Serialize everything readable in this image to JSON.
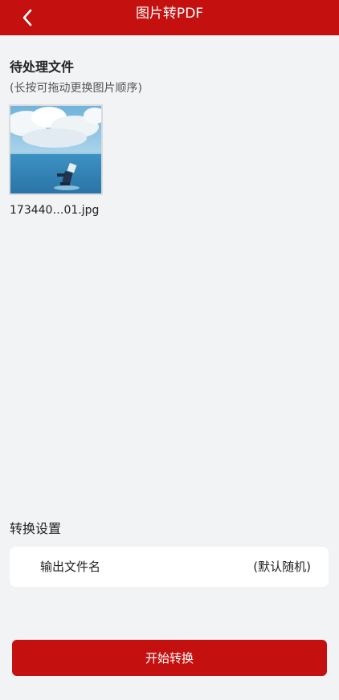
{
  "header": {
    "title": "图片转PDF",
    "back_icon": "chevron-left-icon",
    "color": "#c4100f"
  },
  "pending": {
    "title": "待处理文件",
    "hint": "(长按可拖动更换图片顺序)",
    "files": [
      {
        "name": "173440…01.jpg"
      }
    ]
  },
  "settings": {
    "title": "转换设置",
    "output_label": "输出文件名",
    "output_value": "(默认随机)"
  },
  "action": {
    "start_label": "开始转换"
  }
}
